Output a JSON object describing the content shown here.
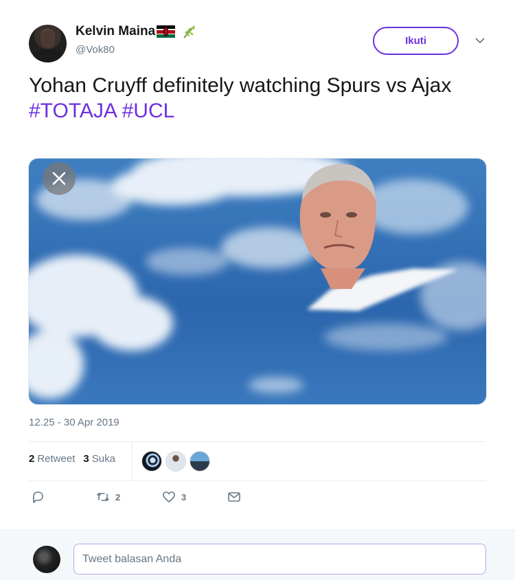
{
  "author": {
    "display_name": "Kelvin Maina",
    "handle": "@Vok80",
    "emoji": [
      "kenya-flag-emoji",
      "leaf-emoji"
    ]
  },
  "follow_label": "Ikuti",
  "tweet": {
    "text": "Yohan Cruyff definitely watching Spurs vs Ajax",
    "hashtags": [
      "#TOTAJA",
      "#UCL"
    ]
  },
  "timestamp": "12.25 - 30 Apr 2019",
  "stats": {
    "retweets": {
      "count": "2",
      "label": "Retweet"
    },
    "likes": {
      "count": "3",
      "label": "Suka"
    }
  },
  "actions": {
    "reply_count": "",
    "retweet_count": "2",
    "like_count": "3"
  },
  "reply": {
    "placeholder": "Tweet balasan Anda"
  },
  "colors": {
    "accent": "#6b2fe0",
    "muted": "#657786"
  }
}
